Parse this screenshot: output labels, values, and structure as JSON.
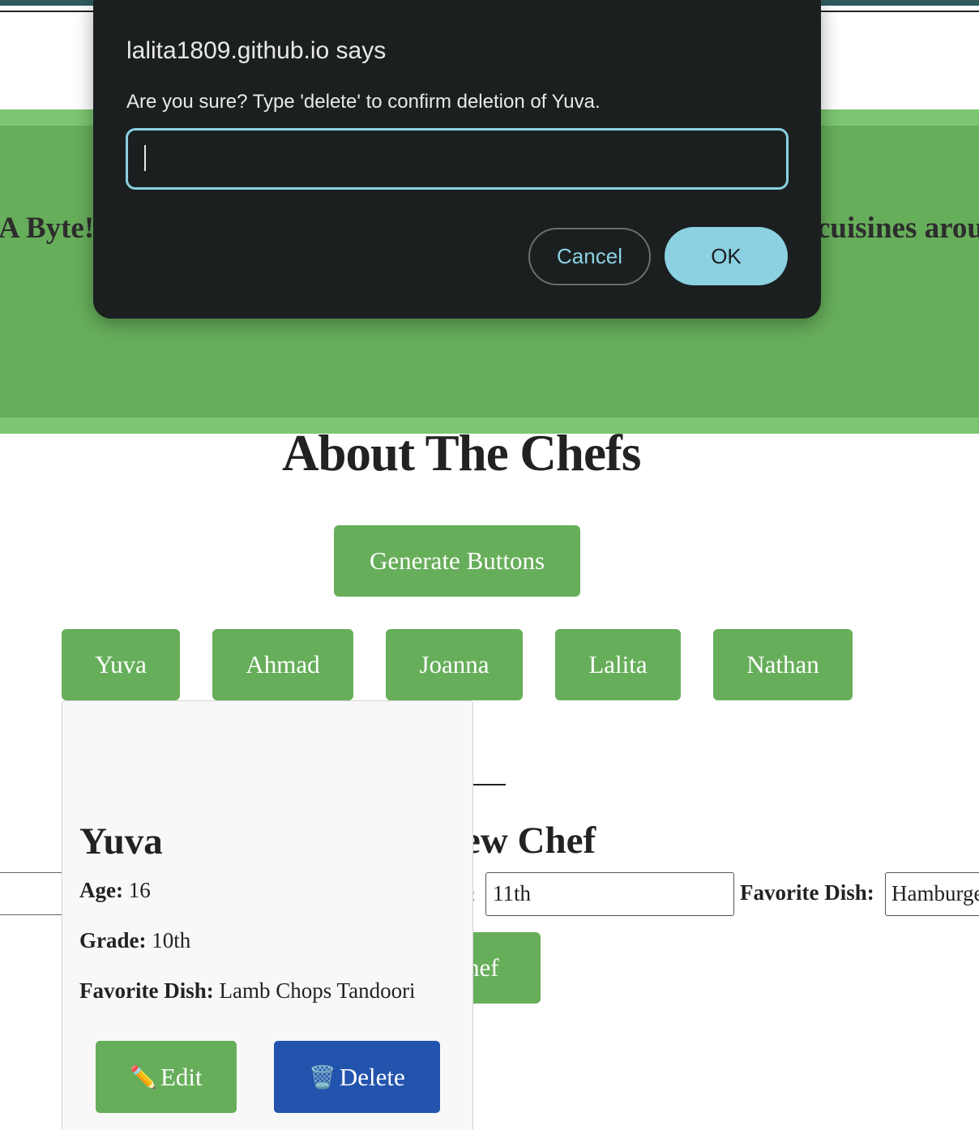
{
  "hero": {
    "left_text": "A Byte!",
    "right_text": "cuisines arou"
  },
  "about": {
    "title": "About The Chefs",
    "generate_label": "Generate Buttons"
  },
  "chef_buttons": [
    "Yuva",
    "Ahmad",
    "Joanna",
    "Lalita",
    "Nathan"
  ],
  "add_form": {
    "title_fragment": "ew Chef",
    "colon_fragment": ":",
    "grade_value": "11th",
    "favorite_label": "Favorite Dish:",
    "dish_value": "Hamburger",
    "submit_fragment": "hef"
  },
  "card": {
    "name": "Yuva",
    "age_label": "Age:",
    "age_value": "16",
    "grade_label": "Grade:",
    "grade_value": "10th",
    "dish_label": "Favorite Dish:",
    "dish_value": "Lamb Chops Tandoori",
    "edit_icon": "✏️",
    "edit_label": "Edit",
    "delete_icon": "🗑️",
    "delete_label": "Delete"
  },
  "dialog": {
    "title": "lalita1809.github.io says",
    "message": "Are you sure? Type 'delete' to confirm deletion of Yuva.",
    "input_value": "",
    "cancel_label": "Cancel",
    "ok_label": "OK"
  },
  "colors": {
    "green": "#67ae5b",
    "light_green": "#7cc571",
    "delete_blue": "#2354ad",
    "dialog_bg": "#1b1f20",
    "dialog_accent": "#8bd1e2"
  }
}
